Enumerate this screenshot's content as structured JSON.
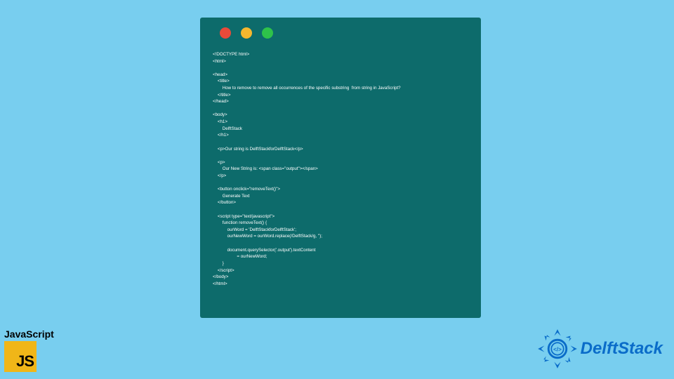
{
  "code": "<!DOCTYPE html>\n<html>\n\n<head>\n    <title>\n        How to remove to remove all occurrences of the specific substring  from string in JavaScript?\n    </title>\n</head>\n\n<body>\n    <h1>\n        DelftStack\n    </h1>\n\n    <p>Our string is DelftStackforDelftStack</p>\n\n    <p>\n        Our New String is: <span class=\"output\"></span>\n    </p>\n\n    <button onclick=\"removeText()\">\n        Generate Text\n    </button>\n\n    <script type=\"text/javascript\">\n        function removeText() {\n            ourWord = 'DelftStackforDelftStack';\n            ourNewWord = ourWord.replace(/DelftStack/g, '');\n\n            document.querySelector('.output').textContent\n                    = ourNewWord;\n        }\n    </script>\n</body>\n</html>",
  "js_badge": {
    "label": "JavaScript",
    "logo_text": "JS"
  },
  "delft": {
    "text": "DelftStack"
  }
}
